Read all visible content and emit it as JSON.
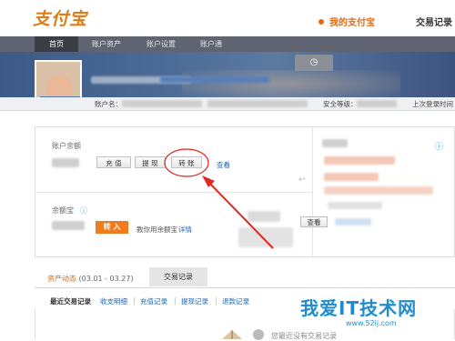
{
  "header": {
    "logo_text": "支付宝",
    "my_alipay": "我的支付宝",
    "trade_records": "交易记录"
  },
  "nav": {
    "items": [
      "首页",
      "账户资产",
      "账户设置",
      "账户通"
    ]
  },
  "infobar": {
    "account_name_label": "账户名：",
    "security_label": "安全等级：",
    "last_login_label": "上次登录时间"
  },
  "balance": {
    "label": "账户余额",
    "recharge": "充 值",
    "withdraw": "提 现",
    "transfer": "转 账",
    "view_link": "查看"
  },
  "yuebao": {
    "label": "余额宝",
    "transfer_in": "转 入",
    "teach_text": "教你用余额宝",
    "detail_link": "详情"
  },
  "right_panel": {
    "view_button": "查看"
  },
  "records": {
    "asset_tab": "资产动态",
    "date_range": "(03.01 - 03.27)",
    "records_tab": "交易记录",
    "sub_links": [
      "最近交易记录",
      "收支明细",
      "充值记录",
      "提现记录",
      "退款记录"
    ],
    "separator": "|",
    "footer_text": "您最近没有交易记录"
  },
  "watermark": {
    "main": "我爱IT技术网",
    "url": "www.52ij.com"
  },
  "colors": {
    "accent_orange": "#f07c1b",
    "link_blue": "#1a64b8",
    "annotation_red": "#e3261f"
  }
}
